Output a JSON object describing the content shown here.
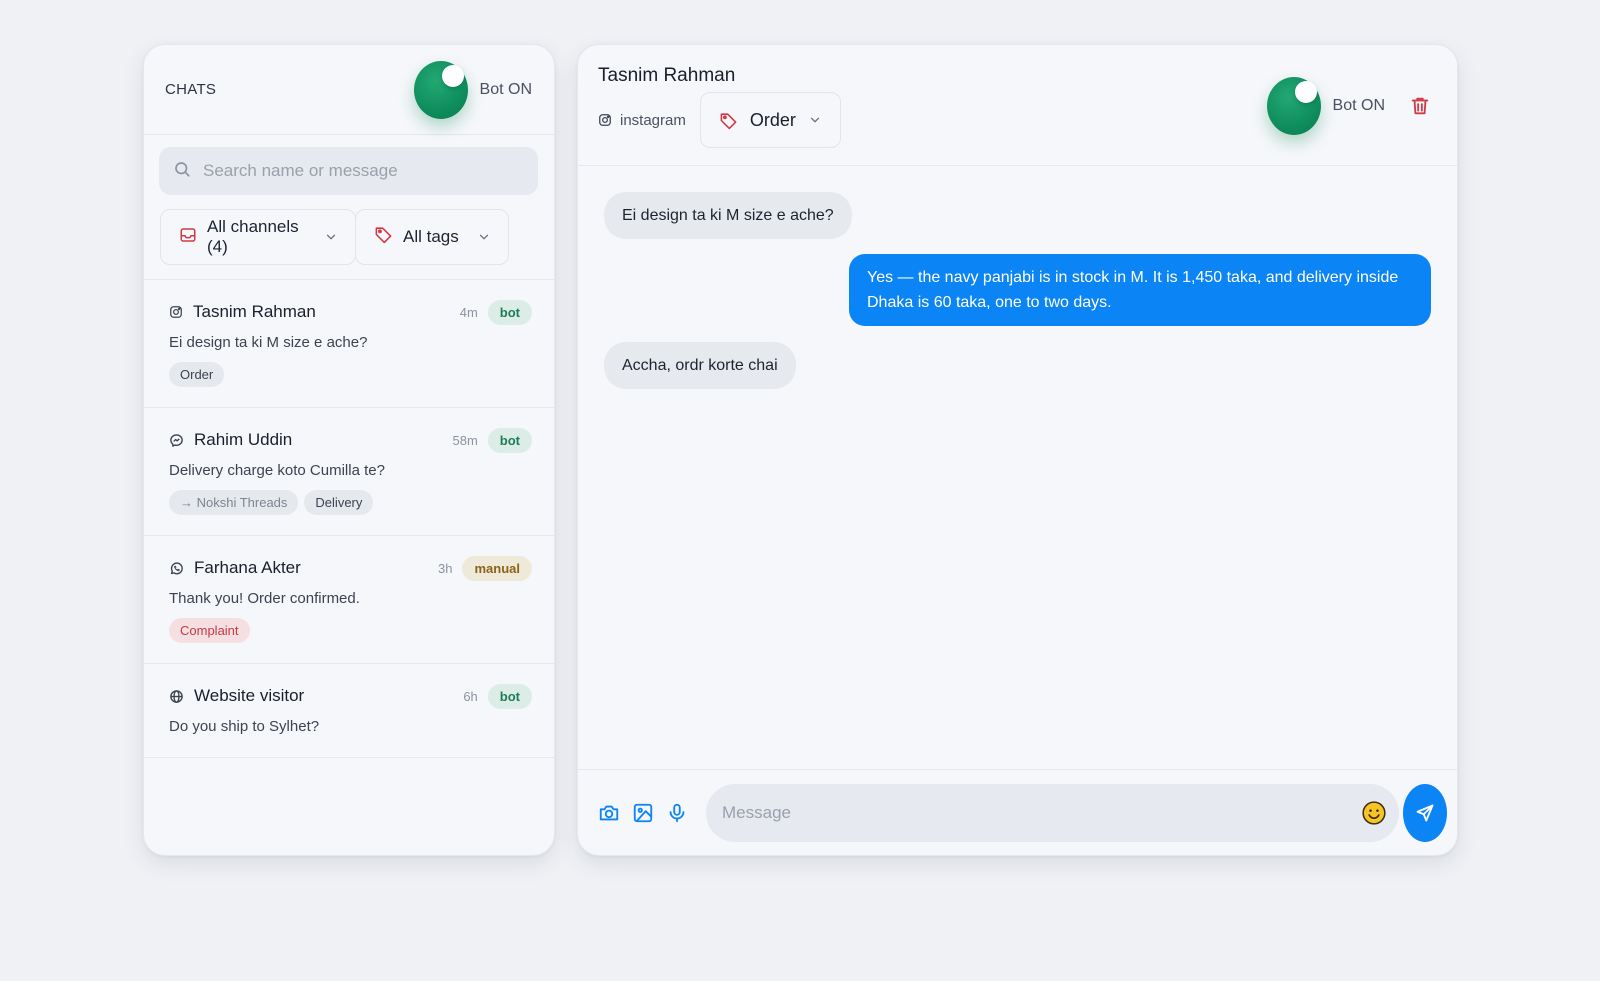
{
  "sidebar": {
    "title": "CHATS",
    "bot_toggle_label": "Bot ON",
    "search_placeholder": "Search name or message",
    "channel_filter": "All channels (4)",
    "tag_filter": "All tags",
    "chats": [
      {
        "name": "Tasnim Rahman",
        "channel_icon": "instagram-icon",
        "time": "4m",
        "mode": "bot",
        "preview": "Ei design ta ki M size e ache?",
        "tags": [
          "Order"
        ]
      },
      {
        "name": "Rahim Uddin",
        "channel_icon": "messenger-icon",
        "time": "58m",
        "mode": "bot",
        "preview": "Delivery charge koto Cumilla te?",
        "routed_to": "→ Nokshi Threads",
        "tags": [
          "Delivery"
        ]
      },
      {
        "name": "Farhana Akter",
        "channel_icon": "whatsapp-icon",
        "time": "3h",
        "mode": "manual",
        "preview": "Thank you! Order confirmed.",
        "tags": [
          "Complaint"
        ]
      },
      {
        "name": "Website visitor",
        "channel_icon": "globe-icon",
        "time": "6h",
        "mode": "bot",
        "preview": "Do you ship to Sylhet?",
        "tags": []
      }
    ]
  },
  "conversation": {
    "contact_name": "Tasnim Rahman",
    "channel": "instagram",
    "tag": "Order",
    "bot_toggle_label": "Bot ON",
    "messages": [
      {
        "direction": "in",
        "text": "Ei design ta ki M size e ache?"
      },
      {
        "direction": "out",
        "text": "Yes — the navy panjabi is in stock in M. It is 1,450 taka, and delivery inside Dhaka is 60 taka, one to two days."
      },
      {
        "direction": "in",
        "text": "Accha, ordr korte chai"
      }
    ],
    "composer_placeholder": "Message"
  },
  "colors": {
    "accent": "#0b84f5",
    "toggle_on": "#0f8d5d",
    "danger": "#d03a45"
  }
}
